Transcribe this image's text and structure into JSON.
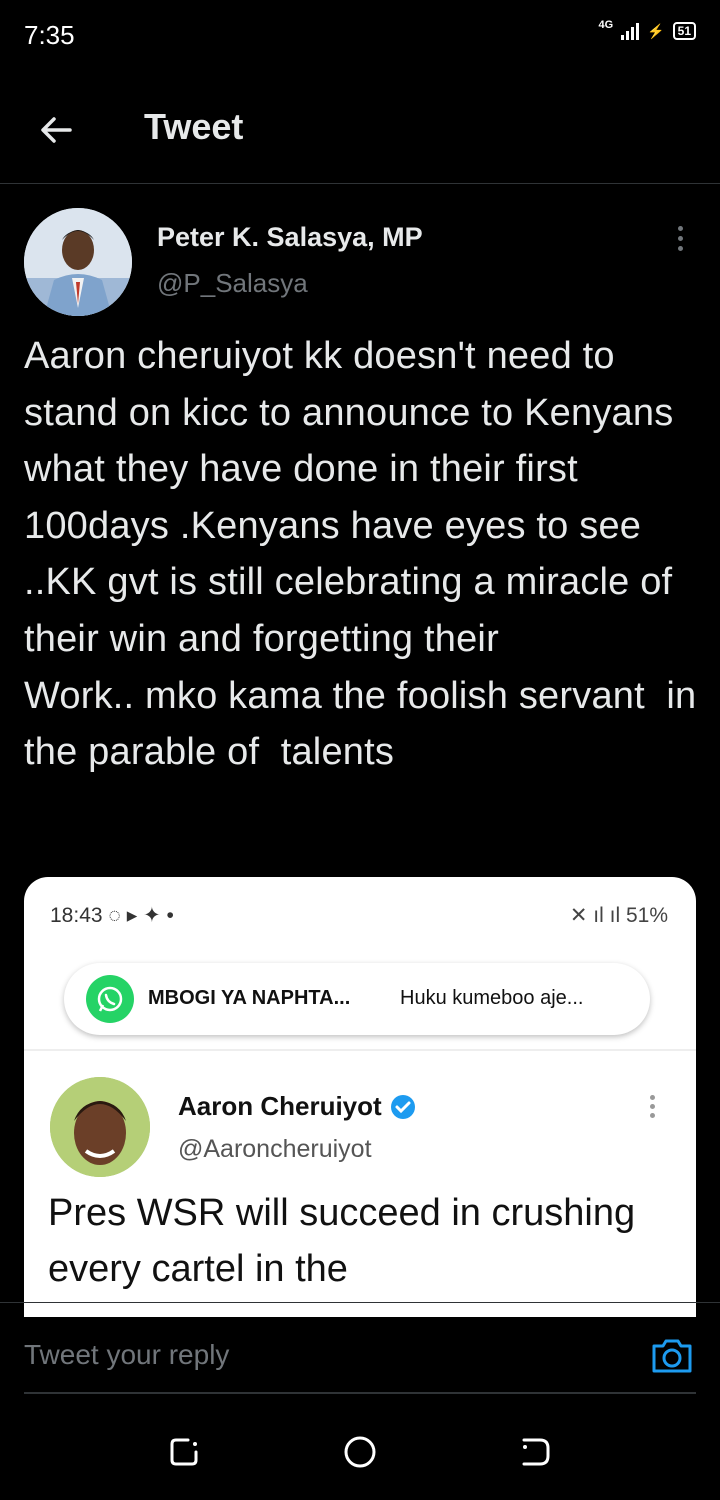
{
  "status": {
    "time": "7:35",
    "network": "4G",
    "battery": "51"
  },
  "header": {
    "title": "Tweet"
  },
  "tweet": {
    "name": "Peter K. Salasya, MP",
    "handle": "@P_Salasya",
    "text": "Aaron cheruiyot kk doesn't need to stand on kicc to announce to Kenyans what they have done in their first 100days .Kenyans have eyes to see ..KK gvt is still celebrating a miracle of their win and forgetting their\nWork.. mko kama the foolish servant  in the parable of  talents"
  },
  "media": {
    "status_time": "18:43",
    "status_battery": "51%",
    "notification_title": "MBOGI YA NAPHTA...",
    "notification_text": "Huku kumeboo aje...",
    "quoted_name": "Aaron Cheruiyot",
    "quoted_handle": "@Aaroncheruiyot",
    "quoted_text": "Pres WSR will succeed in crushing every cartel in the"
  },
  "reply": {
    "placeholder": "Tweet your reply"
  },
  "colors": {
    "accent": "#1d9bf0",
    "background": "#000000",
    "secondary_text": "#71767b"
  }
}
